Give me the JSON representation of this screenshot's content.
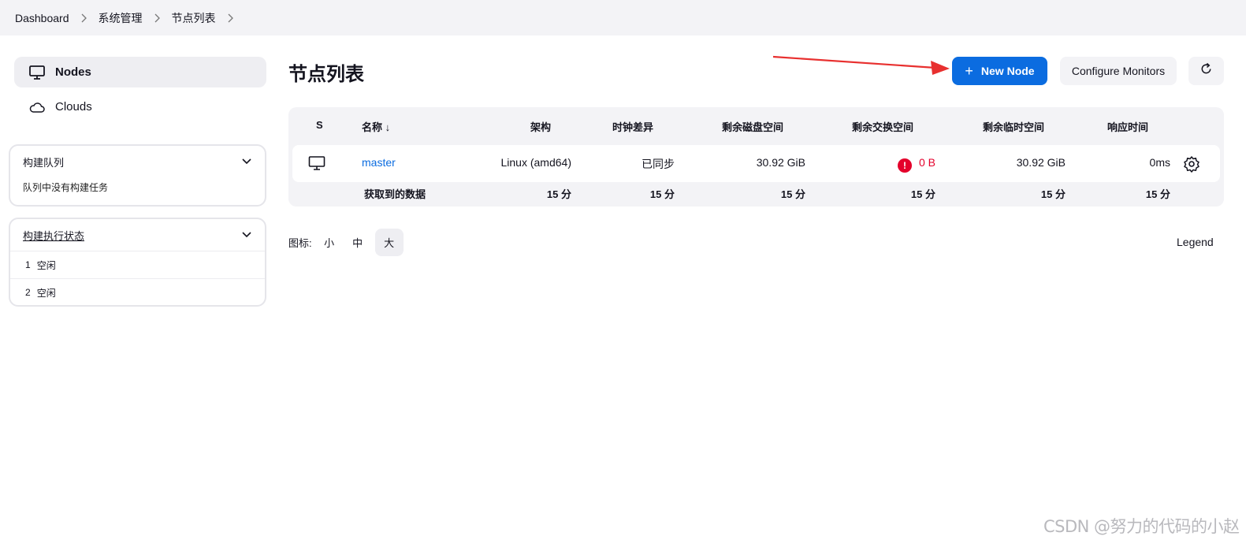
{
  "breadcrumb": [
    "Dashboard",
    "系统管理",
    "节点列表"
  ],
  "sidebar": {
    "nav": [
      {
        "label": "Nodes",
        "icon": "monitor-icon",
        "active": true
      },
      {
        "label": "Clouds",
        "icon": "cloud-icon",
        "active": false
      }
    ],
    "queue": {
      "title": "构建队列",
      "empty_text": "队列中没有构建任务"
    },
    "executors": {
      "title": "构建执行状态",
      "rows": [
        {
          "num": "1",
          "status": "空闲"
        },
        {
          "num": "2",
          "status": "空闲"
        }
      ]
    }
  },
  "page": {
    "title": "节点列表",
    "new_node_label": "New Node",
    "configure_label": "Configure Monitors"
  },
  "table": {
    "headers": {
      "s": "S",
      "name": "名称 ↓",
      "arch": "架构",
      "clock": "时钟差异",
      "disk": "剩余磁盘空间",
      "swap": "剩余交换空间",
      "temp": "剩余临时空间",
      "response": "响应时间"
    },
    "rows": [
      {
        "name": "master",
        "arch": "Linux (amd64)",
        "clock": "已同步",
        "disk": "30.92 GiB",
        "swap": "0 B",
        "temp": "30.92 GiB",
        "response": "0ms"
      }
    ],
    "footer": {
      "label": "获取到的数据",
      "arch": "15 分",
      "clock": "15 分",
      "disk": "15 分",
      "swap": "15 分",
      "temp": "15 分",
      "response": "15 分"
    }
  },
  "icon_size": {
    "label": "图标:",
    "options": [
      "小",
      "中",
      "大"
    ],
    "selected": "大"
  },
  "legend_label": "Legend",
  "watermark": "CSDN @努力的代码的小赵",
  "colors": {
    "accent": "#0b6ce0",
    "error": "#e4002b",
    "arrow": "#e8302f"
  }
}
